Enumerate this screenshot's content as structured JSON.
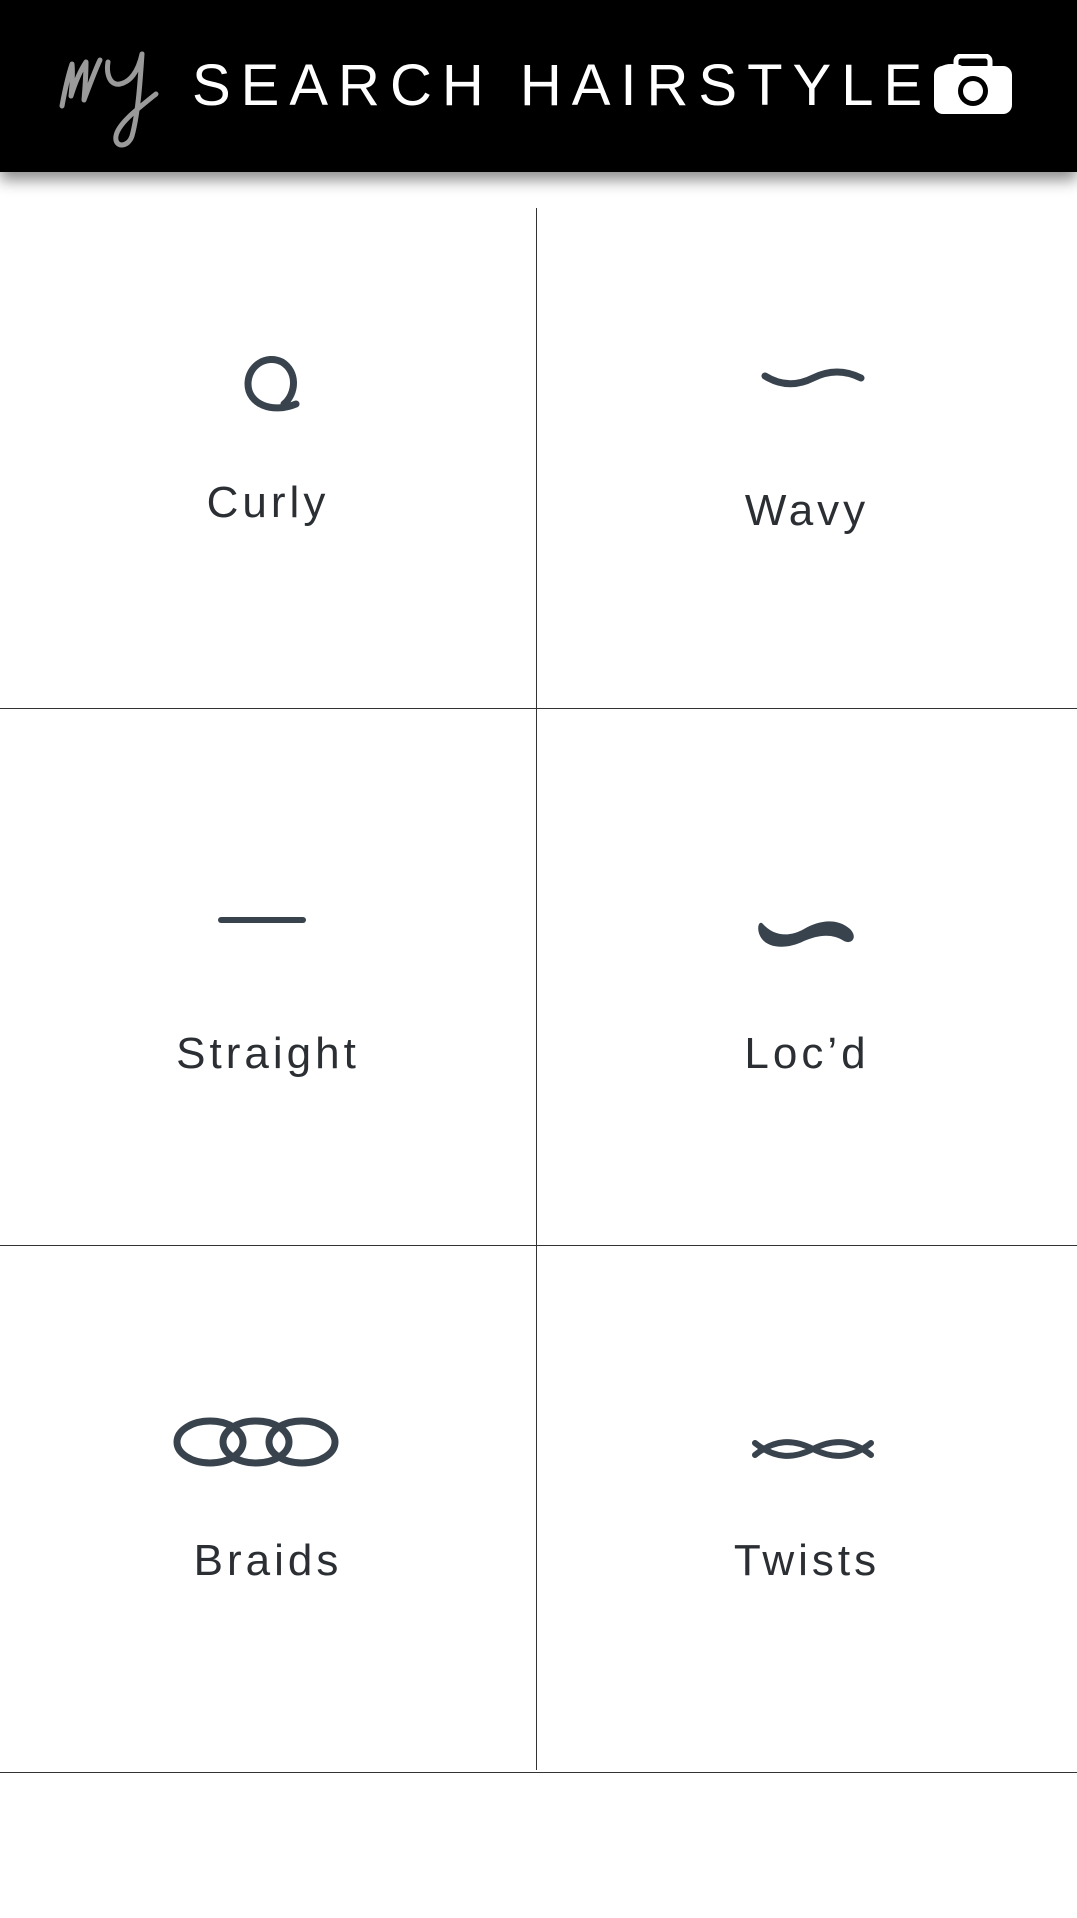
{
  "header": {
    "logo_text": "my",
    "title": "SEARCH HAIRSTYLES",
    "camera_icon": "camera-icon",
    "background": "#000000"
  },
  "categories": [
    {
      "label": "Curly",
      "icon": "curly-icon"
    },
    {
      "label": "Wavy",
      "icon": "wavy-icon"
    },
    {
      "label": "Straight",
      "icon": "straight-icon"
    },
    {
      "label": "Loc’d",
      "icon": "locd-icon"
    },
    {
      "label": "Braids",
      "icon": "braids-icon"
    },
    {
      "label": "Twists",
      "icon": "twists-icon"
    }
  ],
  "colors": {
    "icon": "#38434d",
    "label": "#2b2f33",
    "divider": "#333333"
  }
}
